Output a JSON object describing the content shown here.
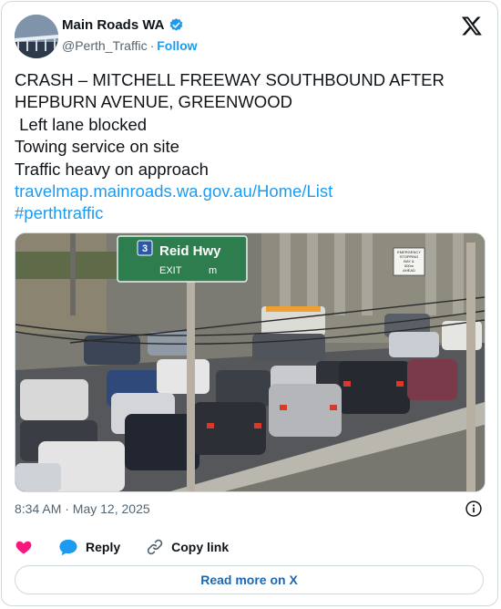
{
  "author": {
    "display_name": "Main Roads WA",
    "handle": "@Perth_Traffic",
    "follow_label": "Follow",
    "avatar_icon": "bridge-photo-avatar",
    "verified_icon": "verified-badge-icon"
  },
  "platform_icon": "x-logo-icon",
  "tweet": {
    "lines": [
      "CRASH – MITCHELL FREEWAY SOUTHBOUND AFTER HEPBURN AVENUE, GREENWOOD",
      " Left lane blocked",
      "Towing service on site",
      "Traffic heavy on approach"
    ],
    "link": "travelmap.mainroads.wa.gov.au/Home/List",
    "hashtag": "#perthtraffic"
  },
  "media": {
    "sign_route": "3",
    "sign_text": "Reid Hwy",
    "sign_exit": "EXIT",
    "sign_distance": "m",
    "small_sign_lines": [
      "EMERGENCY",
      "STOPPING",
      "BAY &",
      "500m",
      "AHEAD"
    ]
  },
  "timestamp": "8:34 AM · May 12, 2025",
  "actions": {
    "like_icon": "heart-icon",
    "reply_label": "Reply",
    "copy_link_label": "Copy link"
  },
  "read_more_label": "Read more on X",
  "colors": {
    "accent": "#1d9bf0",
    "like": "#f91880",
    "sign_green": "#2e7d4f",
    "read_more_text": "#1d67b0"
  }
}
